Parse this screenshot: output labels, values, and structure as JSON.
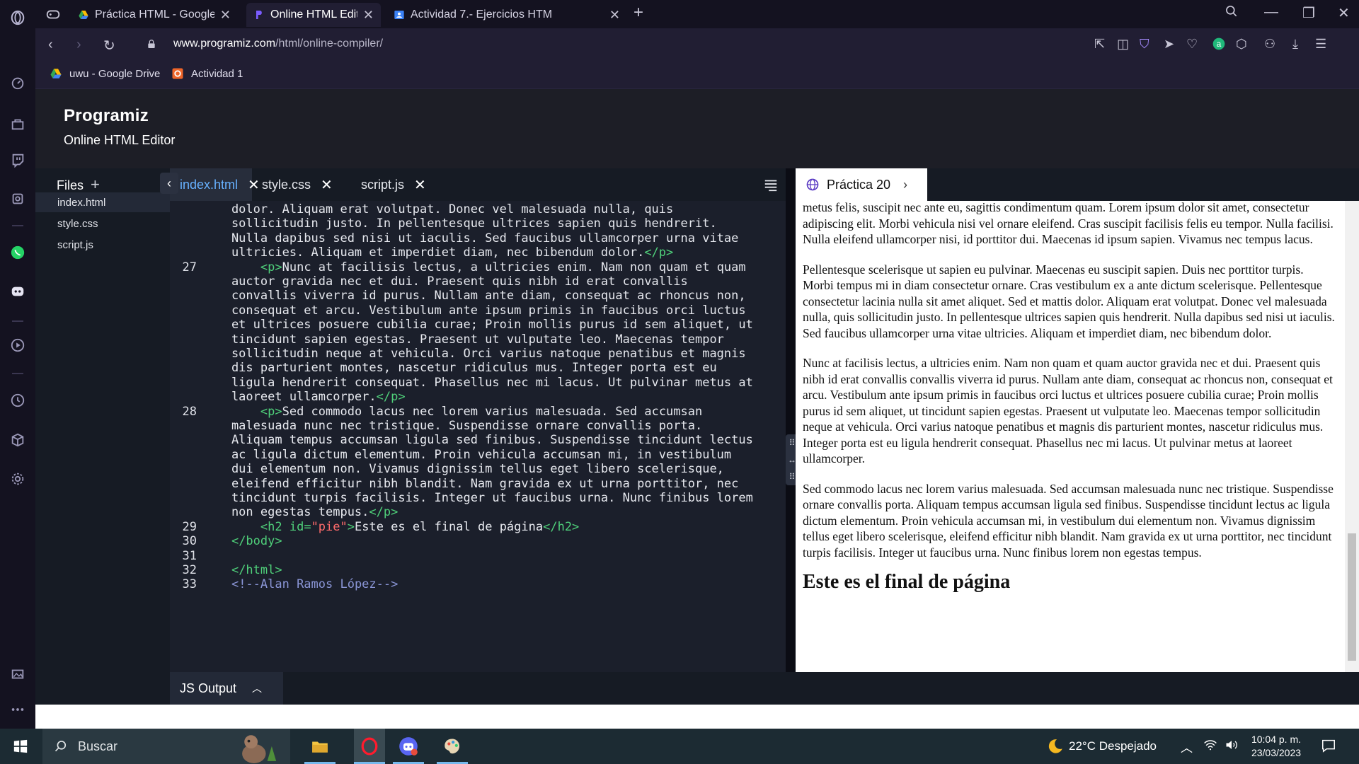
{
  "browser": {
    "tabs": [
      {
        "title": "Práctica HTML - Google Dr",
        "active": false
      },
      {
        "title": "Online HTML Editor",
        "active": true
      },
      {
        "title": "Actividad 7.- Ejercicios HTM",
        "active": false
      }
    ],
    "url_host": "www.programiz.com",
    "url_path": "/html/online-compiler/",
    "bookmarks": [
      {
        "label": "uwu - Google Drive",
        "icon": "google-drive-icon"
      },
      {
        "label": "Actividad 1",
        "icon": "html-icon"
      }
    ]
  },
  "app": {
    "logo": "Programiz",
    "subtitle": "Online HTML Editor"
  },
  "files": {
    "title": "Files",
    "items": [
      "index.html",
      "style.css",
      "script.js"
    ]
  },
  "editor": {
    "tabs": [
      "index.html",
      "style.css",
      "script.js"
    ],
    "lines": [
      {
        "n": "",
        "segs": [
          [
            "t",
            "    dolor. Aliquam erat volutpat. Donec vel malesuada nulla, quis"
          ]
        ]
      },
      {
        "n": "",
        "segs": [
          [
            "t",
            "    sollicitudin justo. In pellentesque ultrices sapien quis hendrerit."
          ]
        ]
      },
      {
        "n": "",
        "segs": [
          [
            "t",
            "    Nulla dapibus sed nisi ut iaculis. Sed faucibus ullamcorper urna vitae"
          ]
        ]
      },
      {
        "n": "",
        "segs": [
          [
            "t",
            "    ultricies. Aliquam et imperdiet diam, nec bibendum dolor."
          ],
          [
            "g",
            "</p>"
          ]
        ]
      },
      {
        "n": "27",
        "segs": [
          [
            "t",
            "        "
          ],
          [
            "g",
            "<p>"
          ],
          [
            "t",
            "Nunc at facilisis lectus, a ultricies enim. Nam non quam et quam"
          ]
        ]
      },
      {
        "n": "",
        "segs": [
          [
            "t",
            "    auctor gravida nec et dui. Praesent quis nibh id erat convallis"
          ]
        ]
      },
      {
        "n": "",
        "segs": [
          [
            "t",
            "    convallis viverra id purus. Nullam ante diam, consequat ac rhoncus non,"
          ]
        ]
      },
      {
        "n": "",
        "segs": [
          [
            "t",
            "    consequat et arcu. Vestibulum ante ipsum primis in faucibus orci luctus"
          ]
        ]
      },
      {
        "n": "",
        "segs": [
          [
            "t",
            "    et ultrices posuere cubilia curae; Proin mollis purus id sem aliquet, ut"
          ]
        ]
      },
      {
        "n": "",
        "segs": [
          [
            "t",
            "    tincidunt sapien egestas. Praesent ut vulputate leo. Maecenas tempor"
          ]
        ]
      },
      {
        "n": "",
        "segs": [
          [
            "t",
            "    sollicitudin neque at vehicula. Orci varius natoque penatibus et magnis"
          ]
        ]
      },
      {
        "n": "",
        "segs": [
          [
            "t",
            "    dis parturient montes, nascetur ridiculus mus. Integer porta est eu"
          ]
        ]
      },
      {
        "n": "",
        "segs": [
          [
            "t",
            "    ligula hendrerit consequat. Phasellus nec mi lacus. Ut pulvinar metus at"
          ]
        ]
      },
      {
        "n": "",
        "segs": [
          [
            "t",
            "    laoreet ullamcorper."
          ],
          [
            "g",
            "</p>"
          ]
        ]
      },
      {
        "n": "28",
        "segs": [
          [
            "t",
            "        "
          ],
          [
            "g",
            "<p>"
          ],
          [
            "t",
            "Sed commodo lacus nec lorem varius malesuada. Sed accumsan"
          ]
        ]
      },
      {
        "n": "",
        "segs": [
          [
            "t",
            "    malesuada nunc nec tristique. Suspendisse ornare convallis porta."
          ]
        ]
      },
      {
        "n": "",
        "segs": [
          [
            "t",
            "    Aliquam tempus accumsan ligula sed finibus. Suspendisse tincidunt lectus"
          ]
        ]
      },
      {
        "n": "",
        "segs": [
          [
            "t",
            "    ac ligula dictum elementum. Proin vehicula accumsan mi, in vestibulum"
          ]
        ]
      },
      {
        "n": "",
        "segs": [
          [
            "t",
            "    dui elementum non. Vivamus dignissim tellus eget libero scelerisque,"
          ]
        ]
      },
      {
        "n": "",
        "segs": [
          [
            "t",
            "    eleifend efficitur nibh blandit. Nam gravida ex ut urna porttitor, nec"
          ]
        ]
      },
      {
        "n": "",
        "segs": [
          [
            "t",
            "    tincidunt turpis facilisis. Integer ut faucibus urna. Nunc finibus lorem"
          ]
        ]
      },
      {
        "n": "",
        "segs": [
          [
            "t",
            "    non egestas tempus."
          ],
          [
            "g",
            "</p>"
          ]
        ]
      },
      {
        "n": "29",
        "segs": [
          [
            "t",
            "        "
          ],
          [
            "g",
            "<h2 "
          ],
          [
            "a",
            "id="
          ],
          [
            "s",
            "\"pie\""
          ],
          [
            "g",
            ">"
          ],
          [
            "t",
            "Este es el final de página"
          ],
          [
            "g",
            "</h2>"
          ]
        ]
      },
      {
        "n": "30",
        "segs": [
          [
            "t",
            "    "
          ],
          [
            "g",
            "</body>"
          ]
        ]
      },
      {
        "n": "31",
        "segs": [
          [
            "t",
            ""
          ]
        ]
      },
      {
        "n": "32",
        "segs": [
          [
            "t",
            "    "
          ],
          [
            "g",
            "</html>"
          ]
        ]
      },
      {
        "n": "33",
        "segs": [
          [
            "t",
            "    "
          ],
          [
            "c",
            "<!--Alan Ramos López-->"
          ]
        ]
      }
    ]
  },
  "preview": {
    "tab_title": "Práctica 20",
    "paragraphs": [
      "metus felis, suscipit nec ante eu, sagittis condimentum quam. Lorem ipsum dolor sit amet, consectetur adipiscing elit. Morbi vehicula nisi vel ornare eleifend. Cras suscipit facilisis felis eu tempor. Nulla facilisi. Nulla eleifend ullamcorper nisi, id porttitor dui. Maecenas id ipsum sapien. Vivamus nec tempus lacus.",
      "Pellentesque scelerisque ut sapien eu pulvinar. Maecenas eu suscipit sapien. Duis nec porttitor turpis. Morbi tempus mi in diam consectetur ornare. Cras vestibulum ex a ante dictum scelerisque. Pellentesque consectetur lacinia nulla sit amet aliquet. Sed et mattis dolor. Aliquam erat volutpat. Donec vel malesuada nulla, quis sollicitudin justo. In pellentesque ultrices sapien quis hendrerit. Nulla dapibus sed nisi ut iaculis. Sed faucibus ullamcorper urna vitae ultricies. Aliquam et imperdiet diam, nec bibendum dolor.",
      "Nunc at facilisis lectus, a ultricies enim. Nam non quam et quam auctor gravida nec et dui. Praesent quis nibh id erat convallis convallis viverra id purus. Nullam ante diam, consequat ac rhoncus non, consequat et arcu. Vestibulum ante ipsum primis in faucibus orci luctus et ultrices posuere cubilia curae; Proin mollis purus id sem aliquet, ut tincidunt sapien egestas. Praesent ut vulputate leo. Maecenas tempor sollicitudin neque at vehicula. Orci varius natoque penatibus et magnis dis parturient montes, nascetur ridiculus mus. Integer porta est eu ligula hendrerit consequat. Phasellus nec mi lacus. Ut pulvinar metus at laoreet ullamcorper.",
      "Sed commodo lacus nec lorem varius malesuada. Sed accumsan malesuada nunc nec tristique. Suspendisse ornare convallis porta. Aliquam tempus accumsan ligula sed finibus. Suspendisse tincidunt lectus ac ligula dictum elementum. Proin vehicula accumsan mi, in vestibulum dui elementum non. Vivamus dignissim tellus eget libero scelerisque, eleifend efficitur nibh blandit. Nam gravida ex ut urna porttitor, nec tincidunt turpis facilisis. Integer ut faucibus urna. Nunc finibus lorem non egestas tempus."
    ],
    "heading": "Este es el final de página"
  },
  "output": {
    "js_tab": "JS Output"
  },
  "taskbar": {
    "search_placeholder": "Buscar",
    "weather": "22°C  Despejado",
    "time": "10:04 p. m.",
    "date": "23/03/2023"
  },
  "colors": {
    "accent": "#67b1ff",
    "tag_green": "#4fd07a",
    "string_red": "#ff6b6b",
    "comment": "#8a95d6"
  }
}
